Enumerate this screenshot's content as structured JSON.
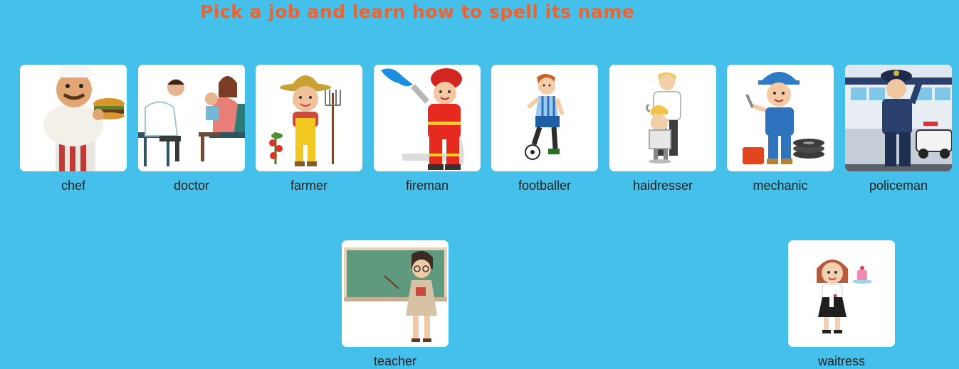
{
  "header": {
    "title": "Pick a job and learn how to spell its name"
  },
  "jobs": [
    {
      "label": "chef",
      "icon": "chef-illustration"
    },
    {
      "label": "doctor",
      "icon": "doctor-illustration"
    },
    {
      "label": "farmer",
      "icon": "farmer-illustration"
    },
    {
      "label": "fireman",
      "icon": "fireman-illustration"
    },
    {
      "label": "footballer",
      "icon": "footballer-illustration"
    },
    {
      "label": "haidresser",
      "icon": "hairdresser-illustration"
    },
    {
      "label": "mechanic",
      "icon": "mechanic-illustration"
    },
    {
      "label": "policeman",
      "icon": "policeman-illustration"
    },
    {
      "label": "teacher",
      "icon": "teacher-illustration"
    },
    {
      "label": "waitress",
      "icon": "waitress-illustration"
    }
  ]
}
